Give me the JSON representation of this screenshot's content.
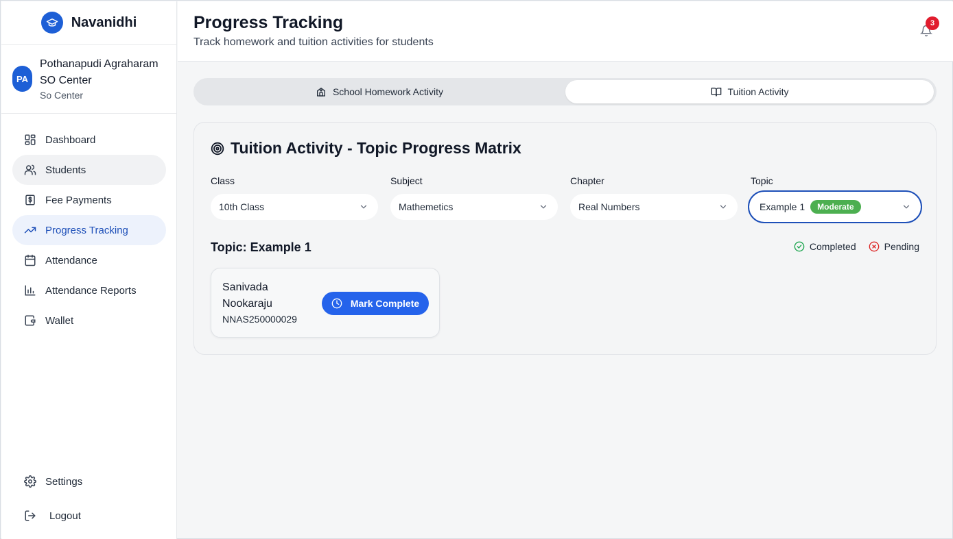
{
  "app": {
    "name": "Navanidhi"
  },
  "center": {
    "initials": "PA",
    "name": "Pothanapudi Agraharam SO Center",
    "type": "So Center"
  },
  "sidebar": {
    "items": [
      {
        "label": "Dashboard",
        "icon": "dashboard-icon"
      },
      {
        "label": "Students",
        "icon": "users-icon"
      },
      {
        "label": "Fee Payments",
        "icon": "dollar-icon"
      },
      {
        "label": "Progress Tracking",
        "icon": "trending-up-icon"
      },
      {
        "label": "Attendance",
        "icon": "calendar-icon"
      },
      {
        "label": "Attendance Reports",
        "icon": "bar-chart-icon"
      },
      {
        "label": "Wallet",
        "icon": "wallet-icon"
      }
    ],
    "bottom": [
      {
        "label": "Settings",
        "icon": "gear-icon"
      },
      {
        "label": "Logout",
        "icon": "logout-icon"
      }
    ]
  },
  "header": {
    "title": "Progress Tracking",
    "subtitle": "Track homework and tuition activities for students",
    "notification_count": "3"
  },
  "tabs": [
    {
      "label": "School Homework Activity",
      "icon": "school-icon"
    },
    {
      "label": "Tuition Activity",
      "icon": "book-open-icon",
      "selected": true
    }
  ],
  "card": {
    "title": "Tuition Activity - Topic Progress Matrix",
    "filters": {
      "class": {
        "label": "Class",
        "value": "10th Class"
      },
      "subject": {
        "label": "Subject",
        "value": "Mathemetics"
      },
      "chapter": {
        "label": "Chapter",
        "value": "Real Numbers"
      },
      "topic": {
        "label": "Topic",
        "value": "Example 1",
        "badge": "Moderate"
      }
    },
    "topic_heading": "Topic: Example 1",
    "legend": {
      "completed": "Completed",
      "pending": "Pending"
    },
    "students": [
      {
        "name": "Sanivada Nookaraju",
        "id": "NNAS250000029",
        "action": "Mark Complete"
      }
    ]
  },
  "colors": {
    "accent": "#2563eb",
    "brand": "#1d5fd6",
    "badge_red": "#e11d2e",
    "moderate": "#4caf50",
    "completed": "#16a34a",
    "pending": "#dc2626"
  }
}
